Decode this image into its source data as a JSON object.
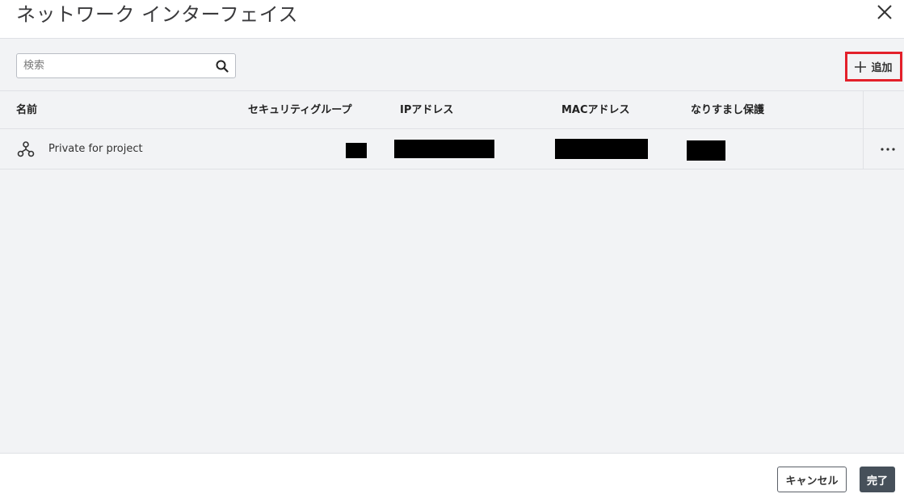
{
  "dialog": {
    "title": "ネットワーク インターフェイス"
  },
  "toolbar": {
    "search_placeholder": "検索",
    "add_label": "追加",
    "highlight_color": "#e3202a"
  },
  "table": {
    "columns": [
      "名前",
      "セキュリティグループ",
      "IPアドレス",
      "MACアドレス",
      "なりすまし保護"
    ],
    "rows": [
      {
        "name": "Private for project",
        "icon": "network-icon",
        "security_group": "[redacted]",
        "ip_address": "[redacted]",
        "mac_address": "[redacted]",
        "spoof_protection": "[redacted]"
      }
    ]
  },
  "footer": {
    "cancel_label": "キャンセル",
    "done_label": "完了"
  }
}
